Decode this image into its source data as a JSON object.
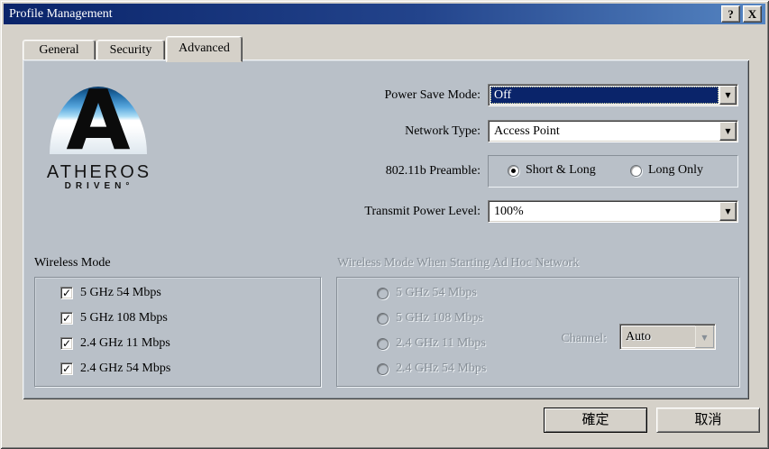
{
  "window": {
    "title": "Profile Management",
    "help_label": "?",
    "close_label": "X"
  },
  "tabs": [
    {
      "label": "General"
    },
    {
      "label": "Security"
    },
    {
      "label": "Advanced"
    }
  ],
  "logo": {
    "letter": "A",
    "brand": "ATHEROS",
    "tagline": "DRIVEN°"
  },
  "fields": {
    "power_save": {
      "label": "Power Save Mode:",
      "value": "Off"
    },
    "network_type": {
      "label": "Network Type:",
      "value": "Access Point"
    },
    "preamble": {
      "label": "802.11b Preamble:",
      "options": [
        {
          "label": "Short & Long",
          "selected": true
        },
        {
          "label": "Long Only",
          "selected": false
        }
      ]
    },
    "transmit_power": {
      "label": "Transmit Power Level:",
      "value": "100%"
    }
  },
  "wireless_mode": {
    "title": "Wireless Mode",
    "options": [
      {
        "label": "5 GHz 54 Mbps",
        "checked": true
      },
      {
        "label": "5 GHz 108 Mbps",
        "checked": true
      },
      {
        "label": "2.4 GHz 11 Mbps",
        "checked": true
      },
      {
        "label": "2.4 GHz 54 Mbps",
        "checked": true
      }
    ]
  },
  "adhoc": {
    "title": "Wireless Mode When Starting Ad Hoc Network",
    "disabled": true,
    "options": [
      {
        "label": "5 GHz 54 Mbps",
        "selected": false
      },
      {
        "label": "5 GHz 108 Mbps",
        "selected": false
      },
      {
        "label": "2.4 GHz 11 Mbps",
        "selected": false
      },
      {
        "label": "2.4 GHz 54 Mbps",
        "selected": false
      }
    ],
    "channel": {
      "label": "Channel:",
      "value": "Auto"
    }
  },
  "buttons": {
    "ok": "確定",
    "cancel": "取消"
  },
  "icons": {
    "checkmark": "✓",
    "dropdown_arrow": "▼"
  },
  "colors": {
    "titlebar_gradient_start": "#0a246a",
    "titlebar_gradient_end": "#5585c2",
    "dialog_face": "#d5d1c9",
    "page_face": "#b9c0c8",
    "selection_fill": "#0a246a",
    "selection_text": "#ffffff",
    "disabled_text": "#878f97"
  }
}
